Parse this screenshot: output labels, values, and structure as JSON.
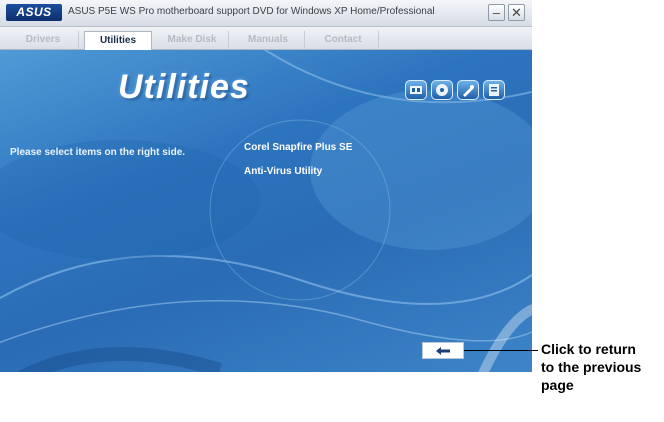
{
  "titlebar": {
    "logo": "ASUS",
    "title": "ASUS P5E WS Pro motherboard support DVD for Windows XP Home/Professional",
    "minimize_icon": "minimize-icon",
    "close_icon": "close-icon"
  },
  "tabs": [
    {
      "label": "Drivers",
      "active": false
    },
    {
      "label": "Utilities",
      "active": true
    },
    {
      "label": "Make Disk",
      "active": false
    },
    {
      "label": "Manuals",
      "active": false
    },
    {
      "label": "Contact",
      "active": false
    }
  ],
  "main": {
    "heading": "Utilities",
    "prompt": "Please select items on the right side.",
    "items": [
      "Corel Snapfire Plus SE",
      "Anti-Virus Utility"
    ],
    "toolbar_icons": [
      "motherboard-info-icon",
      "browse-dvd-icon",
      "filelist-icon",
      "help-icon"
    ],
    "back_icon": "back-arrow-icon"
  },
  "callout": {
    "lines": [
      "Click to return",
      "to the previous",
      "page"
    ]
  },
  "colors": {
    "window_blue": "#2a78c4",
    "tab_bar": "#e6e9ee",
    "heading_text": "#ffffff"
  }
}
